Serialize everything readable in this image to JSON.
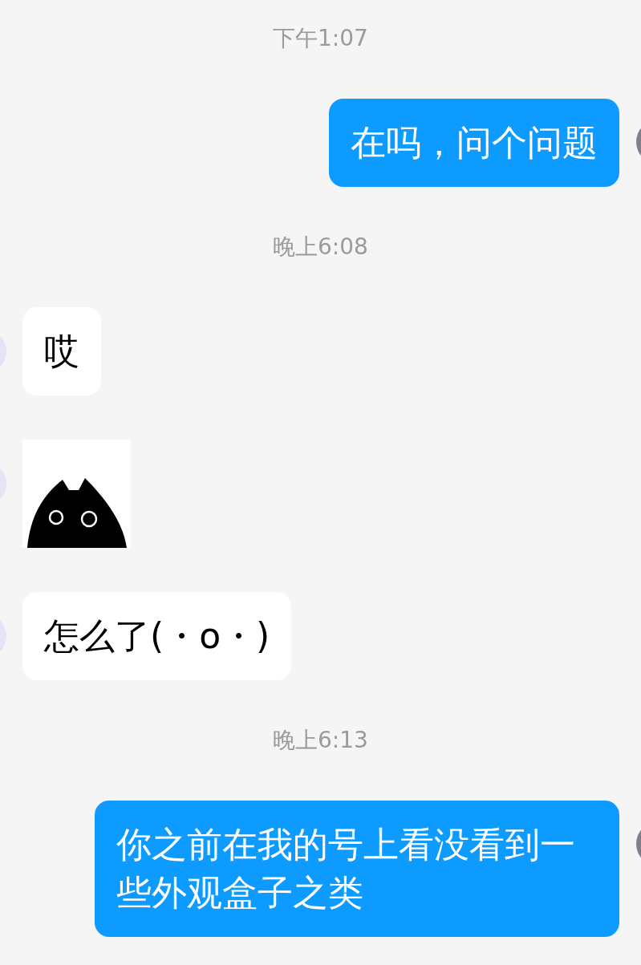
{
  "items": [
    {
      "kind": "time",
      "text": "下午1:07"
    },
    {
      "kind": "text",
      "outgoing": true,
      "text": "在吗，问个问题"
    },
    {
      "kind": "time",
      "text": "晚上6:08"
    },
    {
      "kind": "text",
      "outgoing": false,
      "text": "哎"
    },
    {
      "kind": "sticker",
      "outgoing": false
    },
    {
      "kind": "text",
      "outgoing": false,
      "text": "怎么了(・o・)"
    },
    {
      "kind": "time",
      "text": "晚上6:13"
    },
    {
      "kind": "text",
      "outgoing": true,
      "text": "你之前在我的号上看没看到一些外观盒子之类"
    }
  ]
}
